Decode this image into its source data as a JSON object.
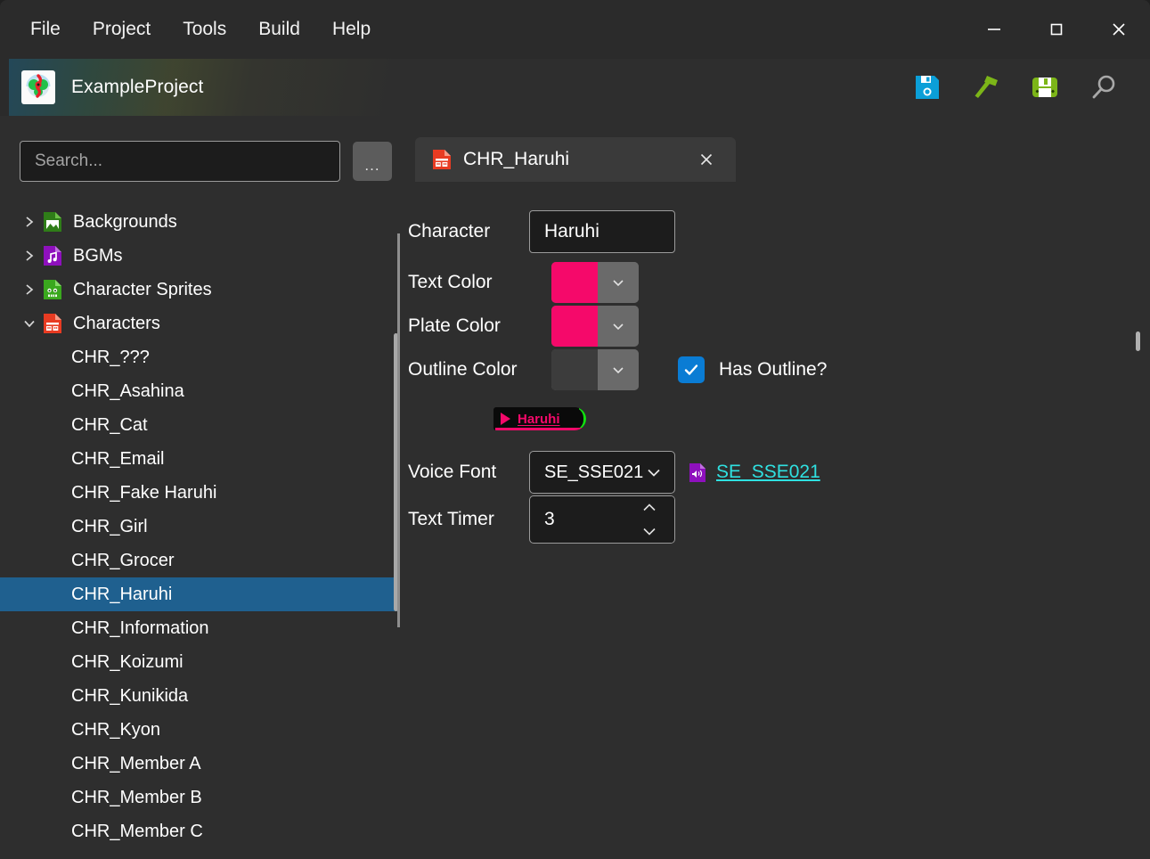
{
  "window": {
    "controls": {
      "minimize": "minimize-button",
      "maximize": "maximize-button",
      "close": "close-button"
    }
  },
  "menubar": {
    "items": [
      {
        "label": "File"
      },
      {
        "label": "Project"
      },
      {
        "label": "Tools"
      },
      {
        "label": "Build"
      },
      {
        "label": "Help"
      }
    ]
  },
  "project_bar": {
    "title": "ExampleProject",
    "icon": "app-logo-icon",
    "tools": [
      {
        "name": "save-icon",
        "color": "#0b9fd8"
      },
      {
        "name": "build-hammer-icon",
        "color": "#7cb518"
      },
      {
        "name": "build-and-run-icon",
        "color": "#7cb518"
      },
      {
        "name": "search-magnifier-icon",
        "color": "#a8a8a8"
      }
    ]
  },
  "sidebar": {
    "search": {
      "placeholder": "Search...",
      "value": ""
    },
    "more_button": "...",
    "tree": [
      {
        "label": "Backgrounds",
        "icon": "image-file-icon",
        "expanded": false,
        "icon_color": "#3a8a1e"
      },
      {
        "label": "BGMs",
        "icon": "music-file-icon",
        "expanded": false,
        "icon_color": "#9b12c6"
      },
      {
        "label": "Character Sprites",
        "icon": "sprite-file-icon",
        "expanded": false,
        "icon_color": "#3aa81e"
      },
      {
        "label": "Characters",
        "icon": "character-table-file-icon",
        "expanded": true,
        "icon_color": "#e83b22"
      }
    ],
    "characters": [
      {
        "label": "CHR_???",
        "selected": false
      },
      {
        "label": "CHR_Asahina",
        "selected": false
      },
      {
        "label": "CHR_Cat",
        "selected": false
      },
      {
        "label": "CHR_Email",
        "selected": false
      },
      {
        "label": "CHR_Fake Haruhi",
        "selected": false
      },
      {
        "label": "CHR_Girl",
        "selected": false
      },
      {
        "label": "CHR_Grocer",
        "selected": false
      },
      {
        "label": "CHR_Haruhi",
        "selected": true
      },
      {
        "label": "CHR_Information",
        "selected": false
      },
      {
        "label": "CHR_Koizumi",
        "selected": false
      },
      {
        "label": "CHR_Kunikida",
        "selected": false
      },
      {
        "label": "CHR_Kyon",
        "selected": false
      },
      {
        "label": "CHR_Member A",
        "selected": false
      },
      {
        "label": "CHR_Member B",
        "selected": false
      },
      {
        "label": "CHR_Member C",
        "selected": false
      }
    ],
    "selection_color": "#1f608f"
  },
  "editor": {
    "tab": {
      "label": "CHR_Haruhi",
      "icon": "character-table-file-icon",
      "close": "✕"
    },
    "fields": {
      "character_label": "Character",
      "character_value": "Haruhi",
      "text_color_label": "Text Color",
      "text_color_value": "#f5096a",
      "plate_color_label": "Plate Color",
      "plate_color_value": "#f5096a",
      "outline_color_label": "Outline Color",
      "outline_color_value": "#3c3c3c",
      "has_outline_label": "Has Outline?",
      "has_outline_checked": true,
      "checkbox_color": "#0a7cd4",
      "voice_font_label": "Voice Font",
      "voice_font_value": "SE_SSE021",
      "voice_font_link": "SE_SSE021",
      "voice_font_link_color": "#2fe0e0",
      "text_timer_label": "Text Timer",
      "text_timer_value": "3"
    },
    "preview": {
      "name": "Haruhi",
      "text_color": "#f5096a",
      "plate_color": "#0a0a0a",
      "accent_color": "#12e010"
    }
  }
}
